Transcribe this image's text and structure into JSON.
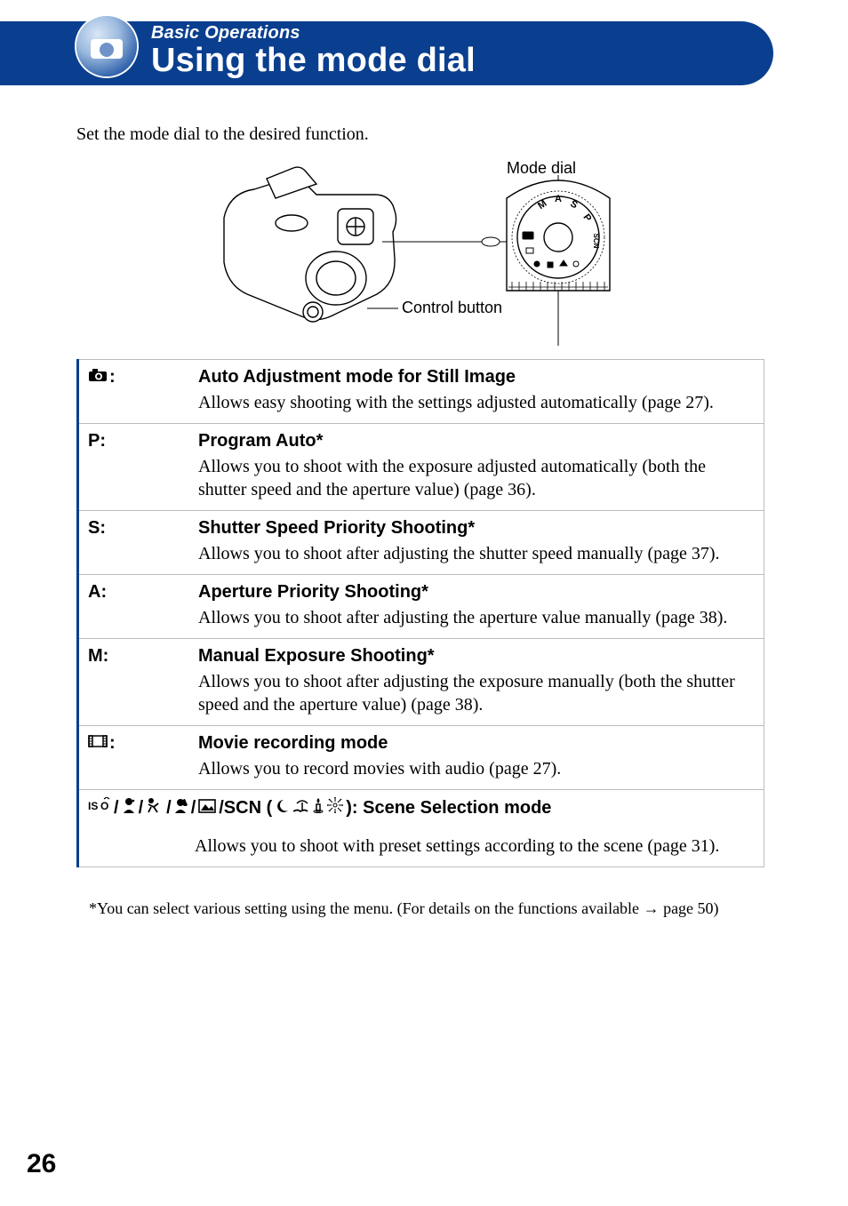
{
  "header": {
    "eyebrow": "Basic Operations",
    "title": "Using the mode dial"
  },
  "intro": "Set the mode dial to the desired function.",
  "diagram": {
    "label_mode_dial": "Mode dial",
    "label_control_button": "Control button",
    "dial_letters": [
      "M",
      "A",
      "S",
      "P",
      "SCN"
    ]
  },
  "modes": [
    {
      "symbol_type": "camera_icon",
      "symbol_text": ":",
      "title": "Auto Adjustment mode for Still Image",
      "desc": "Allows easy shooting with the settings adjusted automatically (page 27)."
    },
    {
      "symbol_type": "text",
      "symbol_text": "P:",
      "title": "Program Auto*",
      "desc": "Allows you to shoot with the exposure adjusted automatically (both the shutter speed and the aperture value) (page 36)."
    },
    {
      "symbol_type": "text",
      "symbol_text": "S:",
      "title": "Shutter Speed Priority Shooting*",
      "desc": "Allows you to shoot after adjusting the shutter speed manually (page 37)."
    },
    {
      "symbol_type": "text",
      "symbol_text": "A:",
      "title": "Aperture Priority Shooting*",
      "desc": "Allows you to shoot after adjusting the aperture value manually (page 38)."
    },
    {
      "symbol_type": "text",
      "symbol_text": "M:",
      "title": "Manual Exposure Shooting*",
      "desc": "Allows you to shoot after adjusting the exposure manually (both the shutter speed and the aperture value) (page 38)."
    },
    {
      "symbol_type": "film_icon",
      "symbol_text": ":",
      "title": "Movie recording mode",
      "desc": "Allows you to record movies with audio (page 27)."
    }
  ],
  "scene_mode": {
    "scn_text": "/SCN ( ",
    "close_text": " ): Scene Selection mode",
    "desc": "Allows you to shoot with preset settings according to the scene (page 31)."
  },
  "footnote": {
    "text_before": "*You can select various setting using the menu. (For details on the functions available ",
    "arrow": "→",
    "text_after": " page 50)"
  },
  "page_number": "26"
}
